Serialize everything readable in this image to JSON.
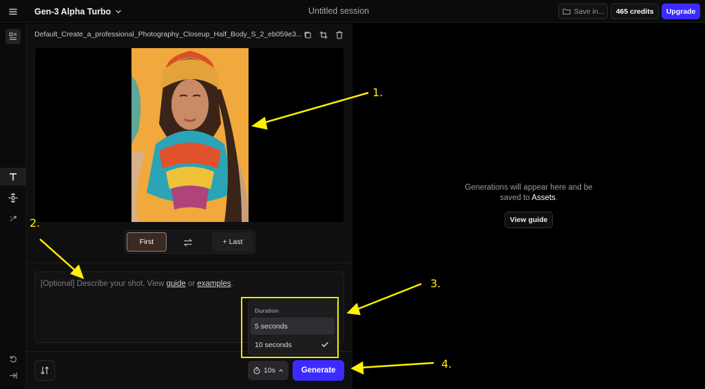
{
  "header": {
    "model_name": "Gen-3 Alpha Turbo",
    "session_title": "Untitled session",
    "save_label": "Save in...",
    "credits_label": "465 credits",
    "upgrade_label": "Upgrade"
  },
  "left_rail": {
    "icons": [
      "assets-icon",
      "text-tool-icon",
      "camera-control-icon",
      "magic-icon",
      "reset-icon",
      "collapse-icon"
    ]
  },
  "editor": {
    "file_name": "Default_Create_a_professional_Photography_Closeup_Half_Body_S_2_eb059e3...",
    "frames": {
      "first_label": "First",
      "last_label": "+ Last"
    },
    "prompt": {
      "text_before": "[Optional] Describe your shot. View ",
      "link_guide": "guide",
      "text_middle": " or ",
      "link_examples": "examples",
      "text_after": "."
    },
    "duration_menu": {
      "title": "Duration",
      "options": [
        {
          "label": "5 seconds",
          "selected": false
        },
        {
          "label": "10 seconds",
          "selected": true
        }
      ]
    },
    "duration_button": "10s",
    "generate_label": "Generate"
  },
  "output": {
    "empty_line1": "Generations will appear here and be",
    "empty_line2_before": "saved to ",
    "empty_assets": "Assets",
    "empty_line2_after": ".",
    "view_guide_label": "View guide"
  },
  "annotations": {
    "labels": [
      "1.",
      "2.",
      "3.",
      "4."
    ],
    "color": "#fff200"
  },
  "colors": {
    "accent": "#3b2bff",
    "background": "#000000",
    "panel": "#0f0f10"
  }
}
